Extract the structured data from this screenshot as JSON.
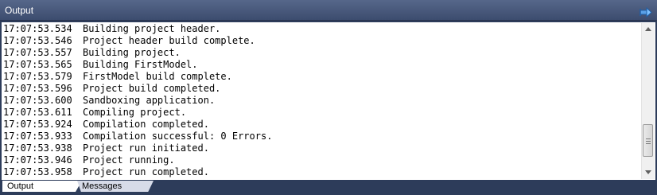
{
  "window": {
    "title": "Output",
    "pin_icon": "pin-icon"
  },
  "log": [
    {
      "time": "17:07:53.534",
      "message": "Building project header."
    },
    {
      "time": "17:07:53.546",
      "message": "Project header build complete."
    },
    {
      "time": "17:07:53.557",
      "message": "Building project."
    },
    {
      "time": "17:07:53.565",
      "message": "Building FirstModel."
    },
    {
      "time": "17:07:53.579",
      "message": "FirstModel build complete."
    },
    {
      "time": "17:07:53.596",
      "message": "Project build completed."
    },
    {
      "time": "17:07:53.600",
      "message": "Sandboxing application."
    },
    {
      "time": "17:07:53.611",
      "message": "Compiling project."
    },
    {
      "time": "17:07:53.924",
      "message": "Compilation completed."
    },
    {
      "time": "17:07:53.933",
      "message": "Compilation successful: 0 Errors."
    },
    {
      "time": "17:07:53.938",
      "message": "Project run initiated."
    },
    {
      "time": "17:07:53.946",
      "message": "Project running."
    },
    {
      "time": "17:07:53.958",
      "message": "Project run completed."
    }
  ],
  "scrollbar": {
    "position": 0.9,
    "visible_fraction": 0.25
  },
  "tabs": [
    {
      "label": "Output",
      "active": true
    },
    {
      "label": "Messages",
      "active": false
    }
  ]
}
